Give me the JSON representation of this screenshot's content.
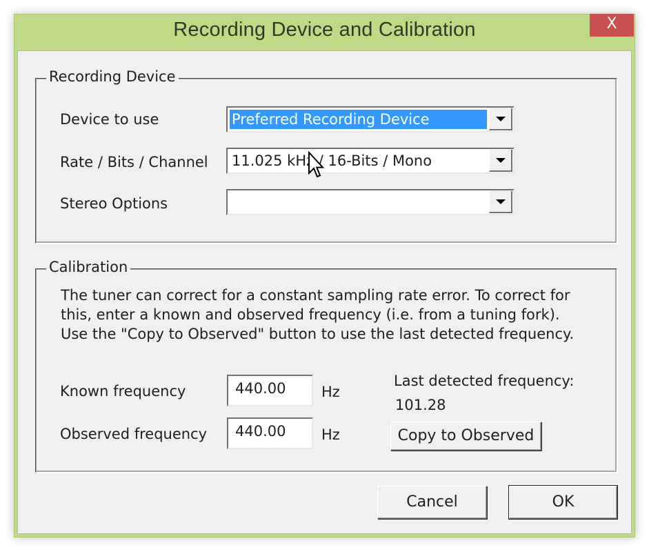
{
  "window": {
    "title": "Recording Device and Calibration",
    "close_label": "X",
    "frame_color": "#bfd986",
    "close_color": "#c9504e"
  },
  "recording_device": {
    "group_label": "Recording Device",
    "fields": [
      {
        "label": "Device to use",
        "value": "Preferred Recording Device",
        "selected": true
      },
      {
        "label": "Rate / Bits / Channel",
        "value": "11.025 kHz / 16-Bits / Mono",
        "selected": false
      },
      {
        "label": "Stereo Options",
        "value": "",
        "selected": false
      }
    ]
  },
  "calibration": {
    "group_label": "Calibration",
    "description": [
      "The tuner can correct for a constant sampling rate error.  To correct for",
      "this, enter a known and observed frequency (i.e. from a tuning fork).",
      "Use the \"Copy to Observed\" button to use the last detected frequency."
    ],
    "known": {
      "label": "Known frequency",
      "value": "440.00",
      "unit": "Hz"
    },
    "observed": {
      "label": "Observed frequency",
      "value": "440.00",
      "unit": "Hz"
    },
    "last_detected_label": "Last detected frequency:",
    "last_detected_value": "101.28",
    "copy_button": "Copy to Observed"
  },
  "buttons": {
    "cancel": "Cancel",
    "ok": "OK"
  }
}
